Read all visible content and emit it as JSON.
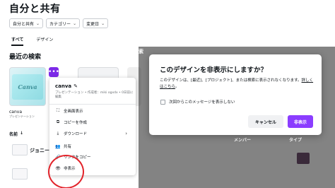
{
  "page": {
    "title": "自分と共有"
  },
  "filters": [
    {
      "label": "自分と共有"
    },
    {
      "label": "カテゴリー"
    },
    {
      "label": "変更日"
    }
  ],
  "tabs": [
    {
      "label": "すべて",
      "active": true
    },
    {
      "label": "デザイン",
      "active": false
    }
  ],
  "recent": {
    "title": "最近の検索",
    "item": {
      "thumb_text": "Canva",
      "name": "canva",
      "subtitle": "プレゼンテーション"
    }
  },
  "list": {
    "header": "名前",
    "row1_label": "ジョニー#",
    "col_member": "メンバー",
    "col_type": "タイプ"
  },
  "overlay_text": {
    "right_fragment": "索"
  },
  "menu": {
    "title": "canva",
    "subtitle": "プレゼンテーション • 作成者：miki ogxdx • 0日前に編集",
    "items": [
      {
        "label": "全画面表示",
        "icon": "fullscreen-icon",
        "glyph": "⛶"
      },
      {
        "label": "コピーを作成",
        "icon": "copy-icon",
        "glyph": "⧉"
      },
      {
        "label": "ダウンロード",
        "icon": "download-icon",
        "glyph": "⤓"
      },
      {
        "label": "共有",
        "icon": "share-icon",
        "glyph": "👥"
      },
      {
        "label": "リンクをコピー",
        "icon": "link-icon",
        "glyph": "🔗"
      },
      {
        "label": "非表示",
        "icon": "hide-icon",
        "glyph": "👁"
      }
    ],
    "more_glyph": "•••",
    "edit_glyph": "✎",
    "arrow_glyph": "›"
  },
  "dialog": {
    "title": "このデザインを非表示にしますか？",
    "body": "このデザインは、[最近]、[プロジェクト]、または検索に表示されなくなります。",
    "link": "詳しくはこちら",
    "link_suffix": "。",
    "checkbox_label": "次回からこのメッセージを表示しない",
    "cancel_label": "キャンセル",
    "confirm_label": "非表示"
  },
  "colors": {
    "accent": "#8b3dff",
    "highlight_circle": "#e2232a"
  }
}
